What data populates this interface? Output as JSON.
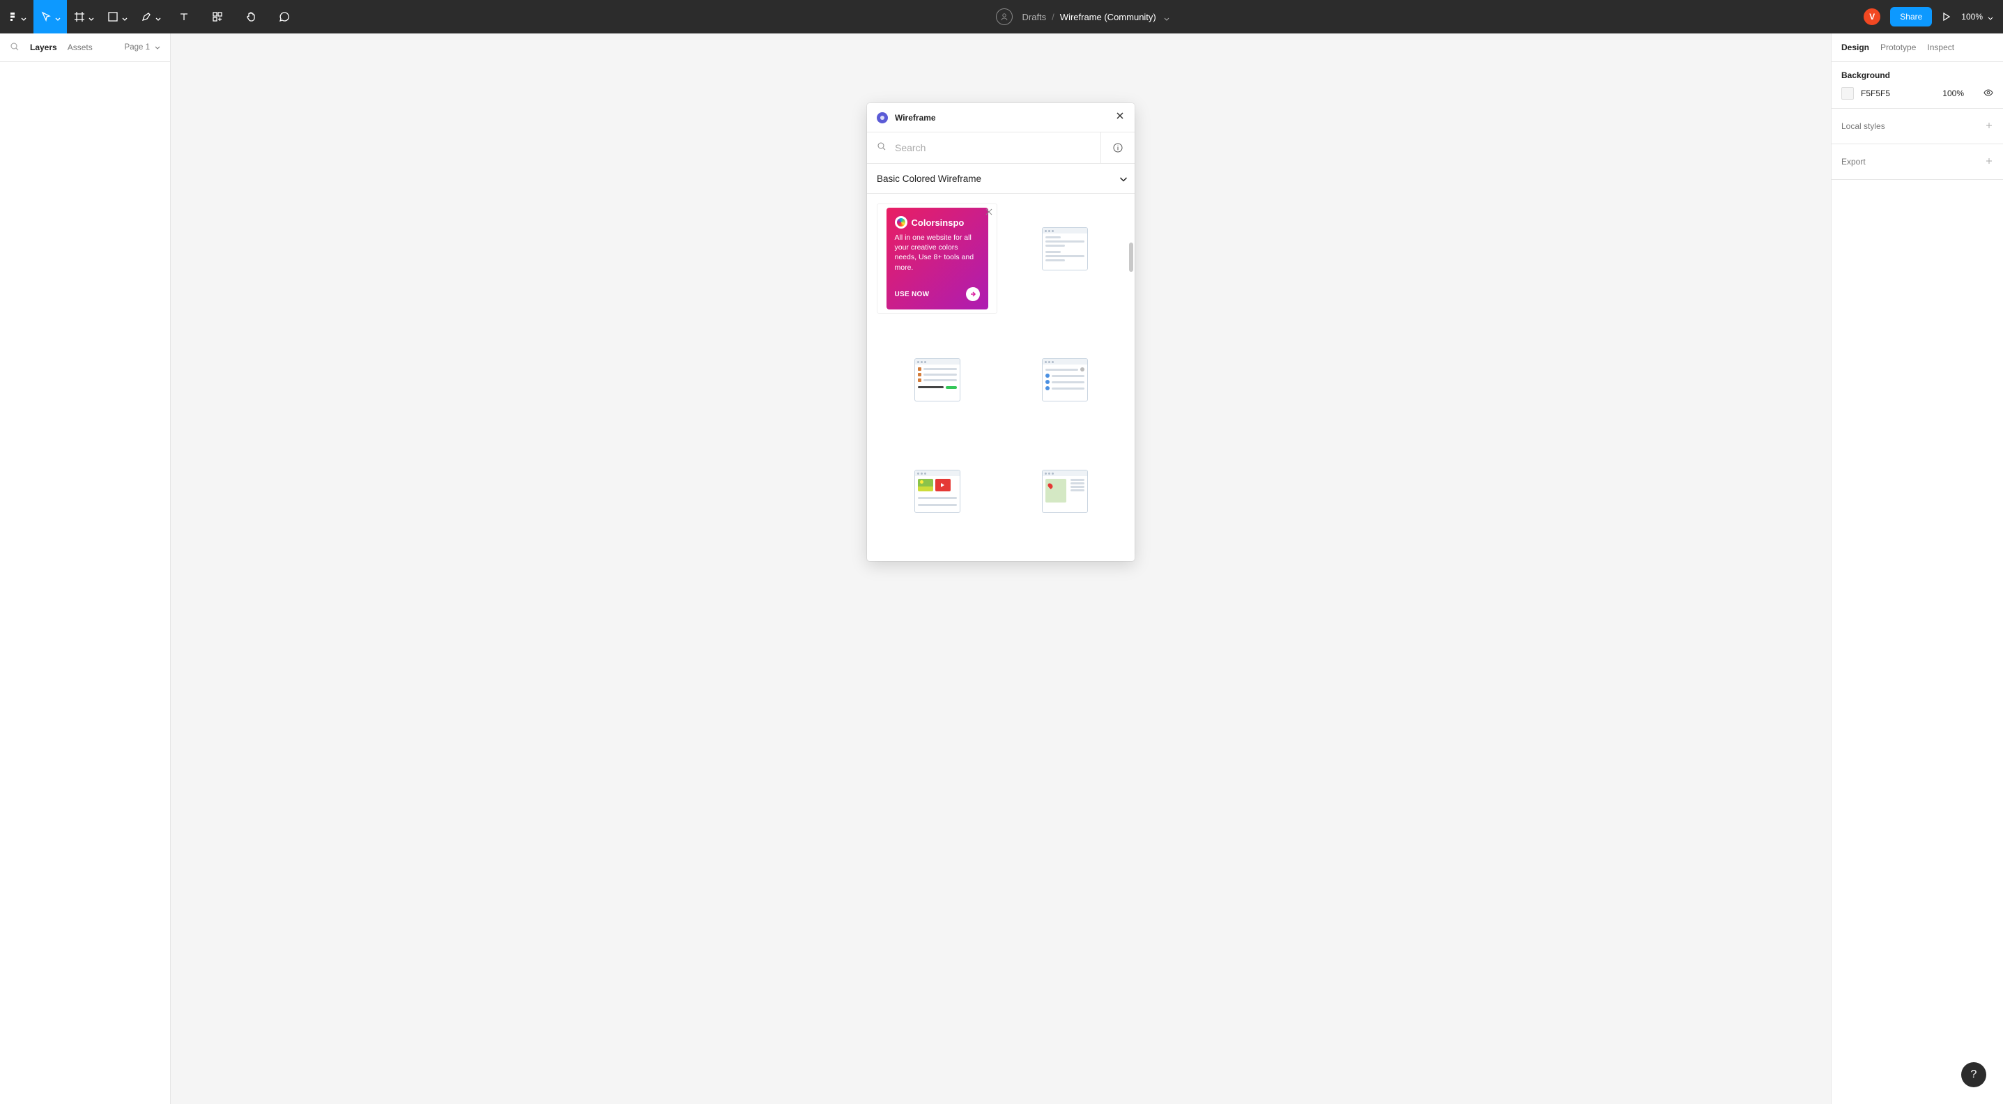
{
  "toolbar": {
    "breadcrumb": {
      "root": "Drafts",
      "current": "Wireframe (Community)"
    },
    "user_initial": "V",
    "share_label": "Share",
    "zoom": "100%"
  },
  "left_panel": {
    "tabs": {
      "layers": "Layers",
      "assets": "Assets"
    },
    "page_label": "Page 1"
  },
  "right_panel": {
    "tabs": {
      "design": "Design",
      "prototype": "Prototype",
      "inspect": "Inspect"
    },
    "background": {
      "title": "Background",
      "hex": "F5F5F5",
      "opacity": "100%"
    },
    "local_styles": "Local styles",
    "export": "Export"
  },
  "library_panel": {
    "title": "Wireframe",
    "search_placeholder": "Search",
    "section": "Basic Colored Wireframe",
    "promo": {
      "brand": "Colorsinspo",
      "body": "All in one website for all your creative colors needs, Use 8+ tools and more.",
      "cta": "USE NOW"
    }
  },
  "help": "?"
}
